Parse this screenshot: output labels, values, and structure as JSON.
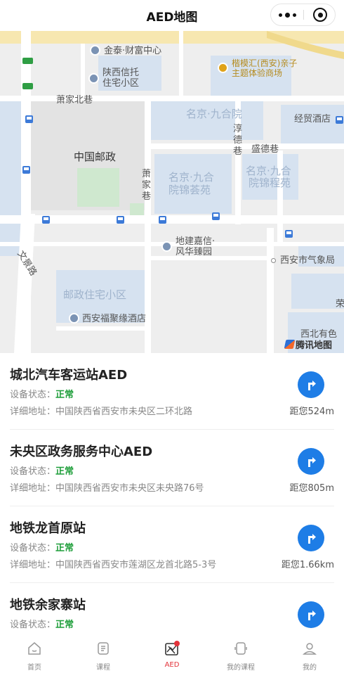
{
  "header": {
    "title": "AED地图"
  },
  "capsule": {
    "more_icon": "more-dots-icon",
    "close_icon": "close-circle-icon"
  },
  "map": {
    "labels": {
      "jintai": "金泰·财富中心",
      "shaanxi_xintuo_1": "陕西信托",
      "shaanxi_xintuo_2": "住宅小区",
      "kaimohui_1": "楷模汇(西安)亲子",
      "kaimohui_2": "主题体验商场",
      "xiaojia_beixiang": "萧家北巷",
      "mingjing_jiuheyuan": "名京·九合院",
      "chun_de_xiang": "淳德巷",
      "jingmao_hotel": "经贸酒店",
      "china_post": "中国邮政",
      "shengde_xiang": "盛德巷",
      "xiaojia_xiang": "萧家巷",
      "mingjing_jinhui_1": "名京·九合",
      "mingjing_jinhui_2": "院锦荟苑",
      "mingjing_jincheng_1": "名京·九合",
      "mingjing_jincheng_2": "院锦程苑",
      "wenjing_road": "文景路",
      "dijian_1": "地建嘉信·",
      "dijian_2": "风华臻园",
      "weather_bureau": "西安市气象局",
      "youzheng_zhuzhai": "邮政住宅小区",
      "fujuyuan_hotel": "西安福聚缘酒店",
      "rong": "荣",
      "northwest": "西北有色",
      "logo": "腾讯地图"
    }
  },
  "list": {
    "status_label": "设备状态：",
    "addr_label": "详细地址：",
    "items": [
      {
        "name": "城北汽车客运站AED",
        "status": "正常",
        "address": "中国陕西省西安市未央区二环北路",
        "distance": "距您524m"
      },
      {
        "name": "未央区政务服务中心AED",
        "status": "正常",
        "address": "中国陕西省西安市未央区未央路76号",
        "distance": "距您805m"
      },
      {
        "name": "地铁龙首原站",
        "status": "正常",
        "address": "中国陕西省西安市莲湖区龙首北路5-3号",
        "distance": "距您1.66km"
      },
      {
        "name": "地铁余家寨站",
        "status": "正常",
        "address": "",
        "distance": ""
      }
    ]
  },
  "tabbar": {
    "tabs": [
      {
        "label": "首页",
        "icon": "home-icon"
      },
      {
        "label": "课程",
        "icon": "course-icon"
      },
      {
        "label": "AED",
        "icon": "aed-map-icon",
        "active": true
      },
      {
        "label": "我的课程",
        "icon": "my-course-icon"
      },
      {
        "label": "我的",
        "icon": "profile-icon"
      }
    ]
  },
  "colors": {
    "accent_blue": "#1e7de6",
    "status_green": "#1e9e3a",
    "active_red": "#e3343b",
    "map_block": "#d6e2f0"
  }
}
